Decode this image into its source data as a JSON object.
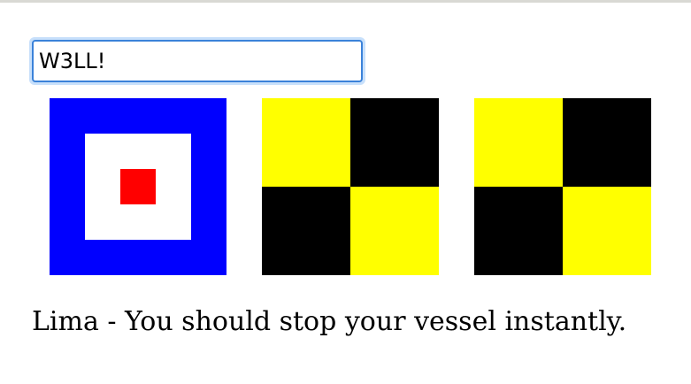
{
  "signal_input": {
    "value": "W3LL!"
  },
  "flags": [
    {
      "letter": "W",
      "name": "whiskey",
      "colors": {
        "outer": "#0000ff",
        "middle": "#ffffff",
        "center": "#ff0000"
      }
    },
    {
      "letter": "L",
      "name": "lima",
      "colors": {
        "top_left": "#ffff00",
        "top_right": "#000000",
        "bottom_left": "#000000",
        "bottom_right": "#ffff00"
      }
    },
    {
      "letter": "L",
      "name": "lima",
      "colors": {
        "top_left": "#ffff00",
        "top_right": "#000000",
        "bottom_left": "#000000",
        "bottom_right": "#ffff00"
      }
    }
  ],
  "meaning_text": "Lima - You should stop your vessel instantly.",
  "colors": {
    "input_border": "#3b82d9",
    "input_focus_ring": "#c8e0fb",
    "top_rule": "#d9d9d4"
  }
}
